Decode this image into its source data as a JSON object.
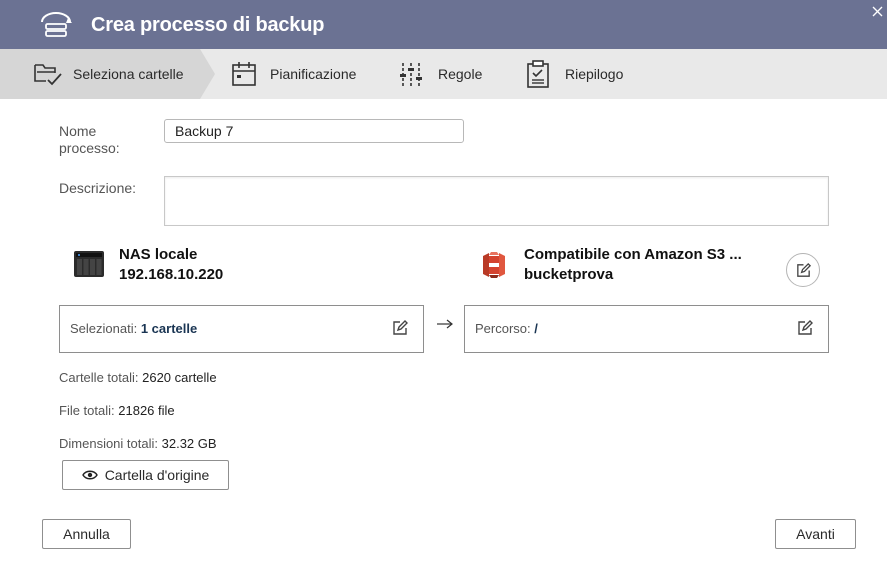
{
  "header": {
    "title": "Crea processo di backup"
  },
  "steps": [
    {
      "label": "Seleziona cartelle",
      "icon": "folder-check-icon",
      "active": true
    },
    {
      "label": "Pianificazione",
      "icon": "calendar-icon"
    },
    {
      "label": "Regole",
      "icon": "sliders-icon"
    },
    {
      "label": "Riepilogo",
      "icon": "clipboard-icon"
    }
  ],
  "form": {
    "name_label_1": "Nome",
    "name_label_2": "processo:",
    "name_value": "Backup 7",
    "description_label": "Descrizione:",
    "description_value": ""
  },
  "source": {
    "name": "NAS locale",
    "address": "192.168.10.220",
    "selected_label": "Selezionati:",
    "selected_value": "1 cartelle"
  },
  "destination": {
    "name": "Compatibile con Amazon S3 ...",
    "bucket": "bucketprova",
    "path_label": "Percorso:",
    "path_value": "/"
  },
  "stats": {
    "folders_label": "Cartelle totali:",
    "folders_value": "2620 cartelle",
    "files_label": "File totali:",
    "files_value": "21826 file",
    "size_label": "Dimensioni totali:",
    "size_value": "32.32 GB"
  },
  "buttons": {
    "source_folder": "Cartella d'origine",
    "cancel": "Annulla",
    "next": "Avanti"
  },
  "colors": {
    "header_bg": "#6b7293",
    "steps_bg": "#e9e9e9",
    "active_step_bg": "#d6d6d6",
    "s3_red": "#d4432f"
  }
}
